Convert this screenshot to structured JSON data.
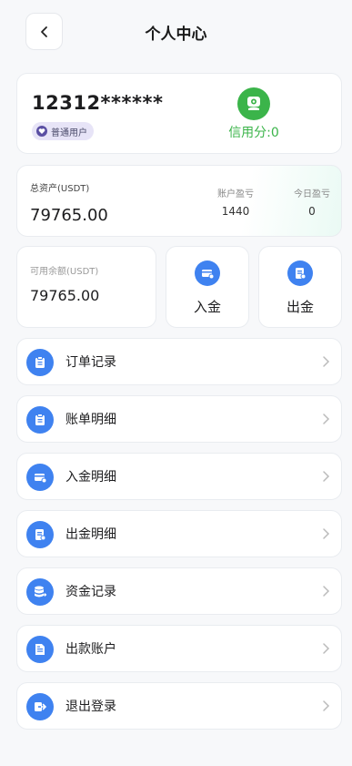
{
  "header": {
    "title": "个人中心"
  },
  "user": {
    "id": "12312******",
    "badge": "普通用户",
    "credit": "信用分:0"
  },
  "assets": {
    "total_label": "总资产(USDT)",
    "total_value": "79765.00",
    "account_pl_label": "账户盈亏",
    "account_pl_value": "1440",
    "today_pl_label": "今日盈亏",
    "today_pl_value": "0"
  },
  "balance": {
    "label": "可用余额(USDT)",
    "value": "79765.00"
  },
  "actions": {
    "deposit": "入金",
    "withdraw": "出金"
  },
  "menu": [
    {
      "label": "订单记录",
      "icon": "clipboard-icon"
    },
    {
      "label": "账单明细",
      "icon": "clipboard-icon"
    },
    {
      "label": "入金明细",
      "icon": "card-in-icon"
    },
    {
      "label": "出金明细",
      "icon": "doc-out-icon"
    },
    {
      "label": "资金记录",
      "icon": "database-icon"
    },
    {
      "label": "出款账户",
      "icon": "document-icon"
    },
    {
      "label": "退出登录",
      "icon": "logout-icon"
    }
  ],
  "colors": {
    "accent": "#3f82f0",
    "credit_green": "#3bb44a",
    "badge_bg": "#e7e4f7"
  }
}
